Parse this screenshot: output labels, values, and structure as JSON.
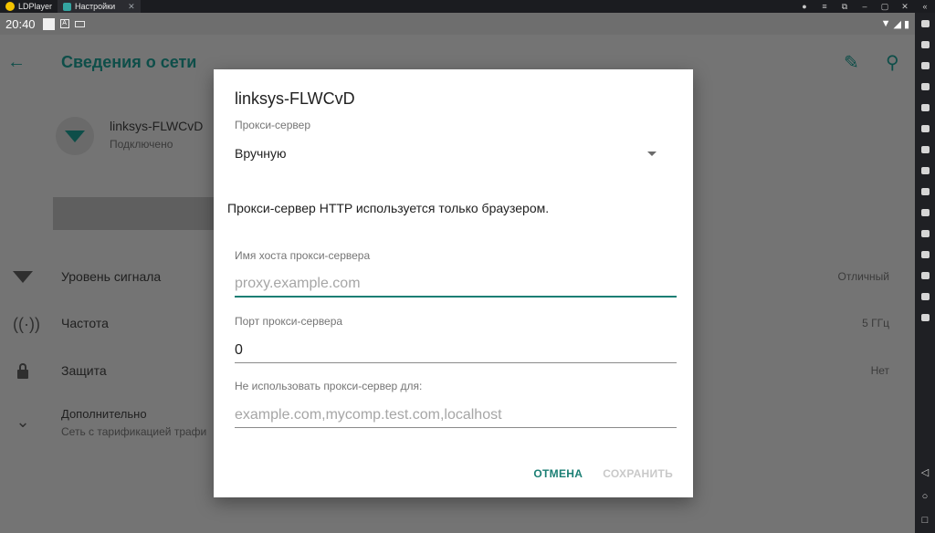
{
  "emulator": {
    "tabs": [
      {
        "label": "LDPlayer"
      },
      {
        "label": "Настройки"
      }
    ]
  },
  "statusbar": {
    "time": "20:40"
  },
  "appbar": {
    "title": "Сведения о сети"
  },
  "network": {
    "name": "linksys-FLWCvD",
    "status": "Подключено"
  },
  "rows": [
    {
      "label": "Уровень сигнала",
      "value": "Отличный",
      "icon": "wifi-signal-icon"
    },
    {
      "label": "Частота",
      "value": "5 ГГц",
      "icon": "frequency-icon"
    },
    {
      "label": "Защита",
      "value": "Нет",
      "icon": "lock-icon"
    },
    {
      "label": "Дополнительно",
      "sub": "Сеть с тарификацией трафи",
      "icon": "chevron-down-icon"
    }
  ],
  "dialog": {
    "title": "linksys-FLWCvD",
    "proxy_caption": "Прокси-сервер",
    "proxy_value": "Вручную",
    "note": "Прокси-сервер HTTP используется только браузером.",
    "host_caption": "Имя хоста прокси-сервера",
    "host_placeholder": "proxy.example.com",
    "port_caption": "Порт прокси-сервера",
    "port_value": "0",
    "bypass_caption": "Не использовать прокси-сервер для:",
    "bypass_placeholder": "example.com,mycomp.test.com,localhost",
    "cancel_label": "ОТМЕНА",
    "save_label": "СОХРАНИТЬ"
  }
}
